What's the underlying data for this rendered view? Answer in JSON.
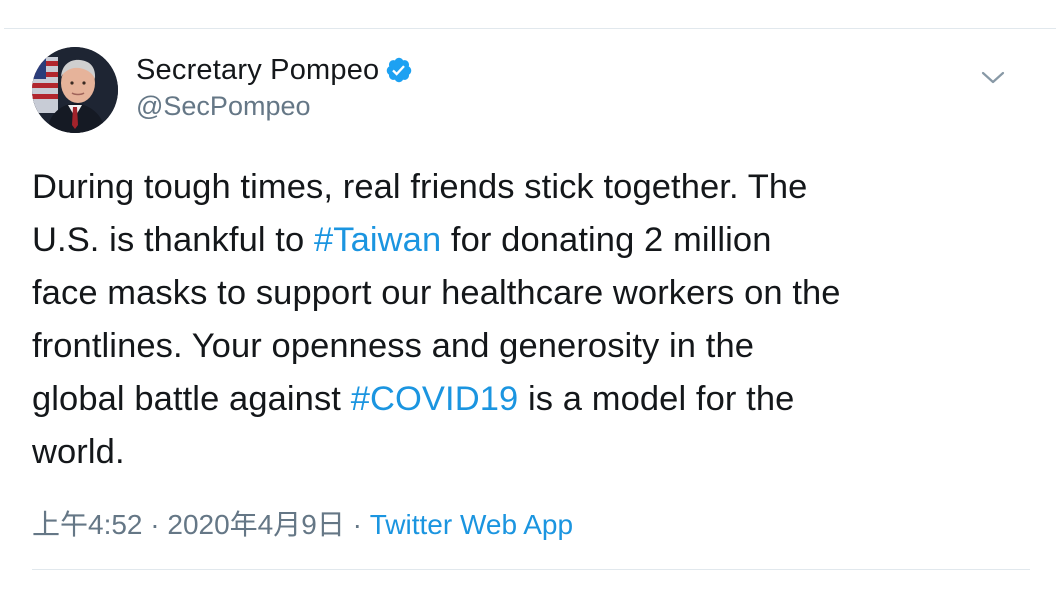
{
  "tweet": {
    "display_name": "Secretary Pompeo",
    "handle": "@SecPompeo",
    "text": {
      "line1": "During tough times, real friends stick together. The",
      "line2_a": "U.S. is thankful to ",
      "hashtag_taiwan": "#Taiwan",
      "line2_b": " for donating 2 million",
      "line3": "face masks to support our healthcare workers on the",
      "line4": "frontlines. Your openness and generosity in the",
      "line5_a": "global battle against ",
      "hashtag_covid": "#COVID19",
      "line5_b": " is a model for the",
      "line6": "world."
    },
    "time": "上午4:52",
    "separator": " · ",
    "date": "2020年4月9日",
    "source": "Twitter Web App"
  },
  "icons": {
    "verified": "verified-badge-icon",
    "menu": "chevron-down-icon"
  },
  "colors": {
    "link": "#1b95e0",
    "text": "#14171a",
    "muted": "#657786",
    "verified": "#1da1f2"
  }
}
